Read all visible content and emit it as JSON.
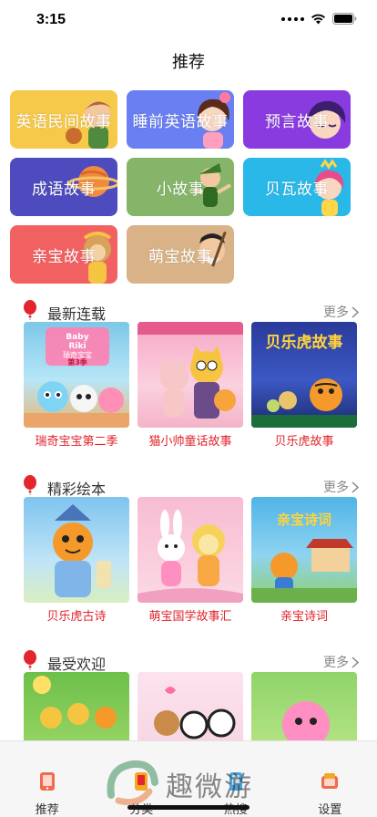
{
  "status": {
    "time": "3:15"
  },
  "nav": {
    "title": "推荐"
  },
  "categories": [
    {
      "label": "英语民间故事",
      "color": "#f6c94a"
    },
    {
      "label": "睡前英语故事",
      "color": "#6a7ff2"
    },
    {
      "label": "预言故事",
      "color": "#8a3be0"
    },
    {
      "label": "成语故事",
      "color": "#4e4bbf"
    },
    {
      "label": "小故事",
      "color": "#86b56a"
    },
    {
      "label": "贝瓦故事",
      "color": "#2ab8e8"
    },
    {
      "label": "亲宝故事",
      "color": "#f26161"
    },
    {
      "label": "萌宝故事",
      "color": "#d9b387"
    }
  ],
  "sections": [
    {
      "title": "最新连载",
      "more": "更多",
      "items": [
        {
          "title": "瑞奇宝宝第二季",
          "badge_line1": "Baby",
          "badge_line2": "Riki",
          "badge_caption": "瑞奇宝宝",
          "badge_season": "第3季"
        },
        {
          "title": "猫小帅童话故事"
        },
        {
          "title": "贝乐虎故事",
          "banner": "贝乐虎故事"
        }
      ]
    },
    {
      "title": "精彩绘本",
      "more": "更多",
      "items": [
        {
          "title": "贝乐虎古诗"
        },
        {
          "title": "萌宝国学故事汇"
        },
        {
          "title": "亲宝诗词",
          "banner": "亲宝诗词"
        }
      ]
    },
    {
      "title": "最受欢迎",
      "more": "更多",
      "items": [
        {
          "title": ""
        },
        {
          "title": ""
        },
        {
          "title": ""
        }
      ]
    }
  ],
  "tabs": [
    {
      "label": "推荐",
      "icon": "phone-book-icon"
    },
    {
      "label": "分类",
      "icon": "category-icon"
    },
    {
      "label": "热搜",
      "icon": "hot-search-icon"
    },
    {
      "label": "设置",
      "icon": "settings-icon"
    }
  ],
  "watermark": {
    "text": "趣微游"
  }
}
